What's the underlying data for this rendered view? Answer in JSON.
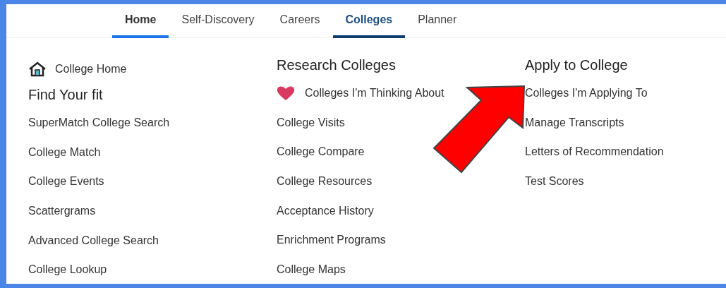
{
  "nav": {
    "tabs": [
      {
        "label": "Home",
        "selected": false,
        "hovered": true
      },
      {
        "label": "Self-Discovery",
        "selected": false,
        "hovered": false
      },
      {
        "label": "Careers",
        "selected": false,
        "hovered": false
      },
      {
        "label": "Colleges",
        "selected": true,
        "hovered": false
      },
      {
        "label": "Planner",
        "selected": false,
        "hovered": false
      }
    ]
  },
  "columns": [
    {
      "lead": {
        "label": "College Home",
        "kind": "home"
      },
      "heading": "Find Your fit",
      "links": [
        {
          "label": "SuperMatch College Search",
          "kind": "plain"
        },
        {
          "label": "College Match",
          "kind": "plain"
        },
        {
          "label": "College Events",
          "kind": "plain"
        },
        {
          "label": "Scattergrams",
          "kind": "plain"
        },
        {
          "label": "Advanced College Search",
          "kind": "plain"
        },
        {
          "label": "College Lookup",
          "kind": "plain"
        }
      ]
    },
    {
      "heading": "Research Colleges",
      "links": [
        {
          "label": "Colleges I'm Thinking About",
          "kind": "favorite"
        },
        {
          "label": "College Visits",
          "kind": "plain"
        },
        {
          "label": "College Compare",
          "kind": "plain"
        },
        {
          "label": "College Resources",
          "kind": "plain"
        },
        {
          "label": "Acceptance History",
          "kind": "plain"
        },
        {
          "label": "Enrichment Programs",
          "kind": "plain"
        },
        {
          "label": "College Maps",
          "kind": "plain"
        }
      ]
    },
    {
      "heading": "Apply to College",
      "links": [
        {
          "label": "Colleges I'm Applying To",
          "kind": "plain"
        },
        {
          "label": "Manage Transcripts",
          "kind": "plain"
        },
        {
          "label": "Letters of Recommendation",
          "kind": "plain"
        },
        {
          "label": "Test Scores",
          "kind": "plain"
        }
      ]
    }
  ],
  "annotation": {
    "kind": "arrow"
  }
}
